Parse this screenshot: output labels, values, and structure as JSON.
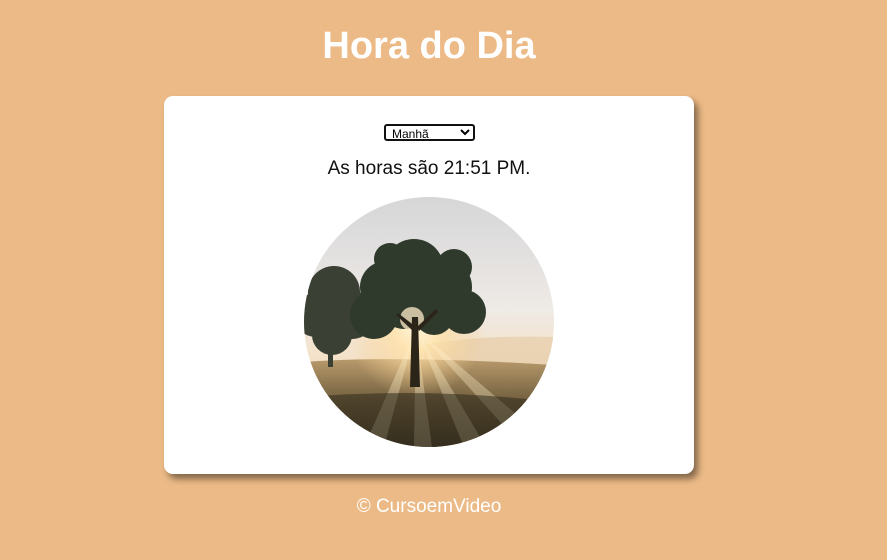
{
  "header": {
    "title": "Hora do Dia"
  },
  "card": {
    "select": {
      "selected": "Manhã",
      "options": [
        "Manhã"
      ]
    },
    "time_message": "As horas são 21:51 PM.",
    "image_alt": "Manhã"
  },
  "footer": {
    "text": "© CursoemVideo"
  },
  "colors": {
    "background": "#ECBA86",
    "card": "#ffffff",
    "title": "#ffffff"
  }
}
